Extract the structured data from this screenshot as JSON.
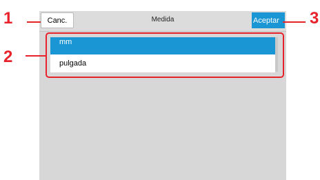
{
  "header": {
    "cancel_label": "Canc.",
    "title": "Medida",
    "accept_label": "Aceptar"
  },
  "unit_list": {
    "items": [
      {
        "label": "mm",
        "selected": true
      },
      {
        "label": "pulgada",
        "selected": false
      }
    ]
  },
  "callouts": {
    "one": "1",
    "two": "2",
    "three": "3"
  },
  "colors": {
    "accent": "#1a96d4",
    "callout": "#e8222b",
    "panel_bg": "#d7d7d7"
  }
}
